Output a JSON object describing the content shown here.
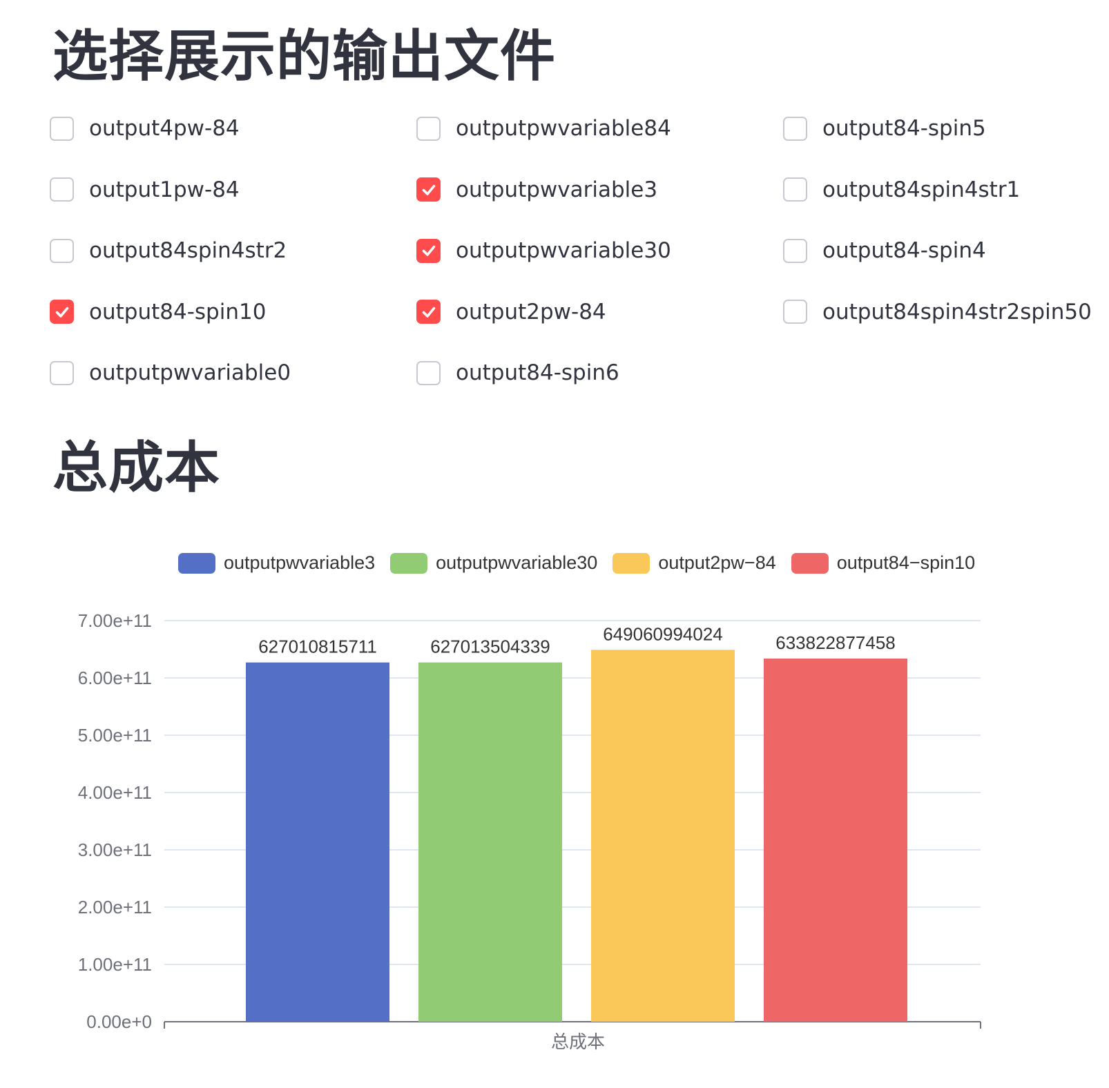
{
  "headings": {
    "select_files": "选择展示的输出文件",
    "total_cost": "总成本"
  },
  "checkboxes": [
    {
      "label": "output4pw-84",
      "checked": false
    },
    {
      "label": "outputpwvariable84",
      "checked": false
    },
    {
      "label": "output84-spin5",
      "checked": false
    },
    {
      "label": "output1pw-84",
      "checked": false
    },
    {
      "label": "outputpwvariable3",
      "checked": true
    },
    {
      "label": "output84spin4str1",
      "checked": false
    },
    {
      "label": "output84spin4str2",
      "checked": false
    },
    {
      "label": "outputpwvariable30",
      "checked": true
    },
    {
      "label": "output84-spin4",
      "checked": false
    },
    {
      "label": "output84-spin10",
      "checked": true
    },
    {
      "label": "output2pw-84",
      "checked": true
    },
    {
      "label": "output84spin4str2spin50",
      "checked": false
    },
    {
      "label": "outputpwvariable0",
      "checked": false
    },
    {
      "label": "output84-spin6",
      "checked": false
    }
  ],
  "colors": {
    "checkbox_checked": "#ff4b4b",
    "checkbox_border": "#c7c9d1",
    "text": "#31333f",
    "series": [
      "#5470c6",
      "#91cc75",
      "#fac858",
      "#ee6666"
    ]
  },
  "chart_data": {
    "type": "bar",
    "categories": [
      "总成本"
    ],
    "series": [
      {
        "name": "outputpwvariable3",
        "values": [
          627010815711
        ],
        "label": "627010815711"
      },
      {
        "name": "outputpwvariable30",
        "values": [
          627013504339
        ],
        "label": "627013504339"
      },
      {
        "name": "output2pw−84",
        "values": [
          649060994024
        ],
        "label": "649060994024"
      },
      {
        "name": "output84−spin10",
        "values": [
          633822877458
        ],
        "label": "633822877458"
      }
    ],
    "ylim": [
      0,
      700000000000
    ],
    "yticks": [
      0,
      100000000000,
      200000000000,
      300000000000,
      400000000000,
      500000000000,
      600000000000,
      700000000000
    ],
    "ytick_labels": [
      "0.00e+0",
      "1.00e+11",
      "2.00e+11",
      "3.00e+11",
      "4.00e+11",
      "5.00e+11",
      "6.00e+11",
      "7.00e+11"
    ],
    "grid": true,
    "legend": "top-center"
  }
}
